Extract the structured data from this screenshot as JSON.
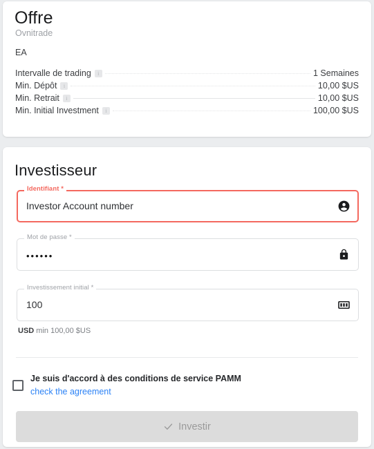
{
  "offer": {
    "title": "Offre",
    "subtitle": "Ovnitrade",
    "type": "EA",
    "specs": [
      {
        "label": "Intervalle de trading",
        "value": "1 Semaines",
        "info": "info-icon",
        "leader": "dotted"
      },
      {
        "label": "Min. Dépôt",
        "value": "10,00 $US",
        "info": "info-icon",
        "leader": "dotted"
      },
      {
        "label": "Min. Retrait",
        "value": "10,00 $US",
        "info": "info-icon",
        "leader": "solid"
      },
      {
        "label": "Min. Initial Investment",
        "value": "100,00 $US",
        "info": "info-icon",
        "leader": "dotted"
      }
    ]
  },
  "investor": {
    "title": "Investisseur",
    "fields": {
      "identifier": {
        "label": "Identifiant *",
        "value": "Investor Account number",
        "placeholder": "Investor Account number",
        "icon": "account-circle-icon",
        "state": "error"
      },
      "password": {
        "label": "Mot de passe *",
        "value": "••••••",
        "placeholder": "",
        "icon": "lock-icon",
        "state": "normal"
      },
      "initial_investment": {
        "label": "Investissement initial *",
        "value": "100",
        "placeholder": "",
        "icon": "money-icon",
        "state": "normal",
        "helper_currency": "USD",
        "helper_text": "min 100,00 $US"
      }
    },
    "agreement": {
      "label": "Je suis d'accord à des conditions de service PAMM",
      "link": "check the agreement",
      "checked": false
    },
    "submit": {
      "label": "Investir",
      "icon": "check-icon",
      "disabled": true
    }
  },
  "colors": {
    "error": "#f4685e",
    "link": "#2b82f6",
    "page_bg": "#ebedef",
    "card_bg": "#ffffff",
    "disabled_button": "#dcdcdc"
  }
}
